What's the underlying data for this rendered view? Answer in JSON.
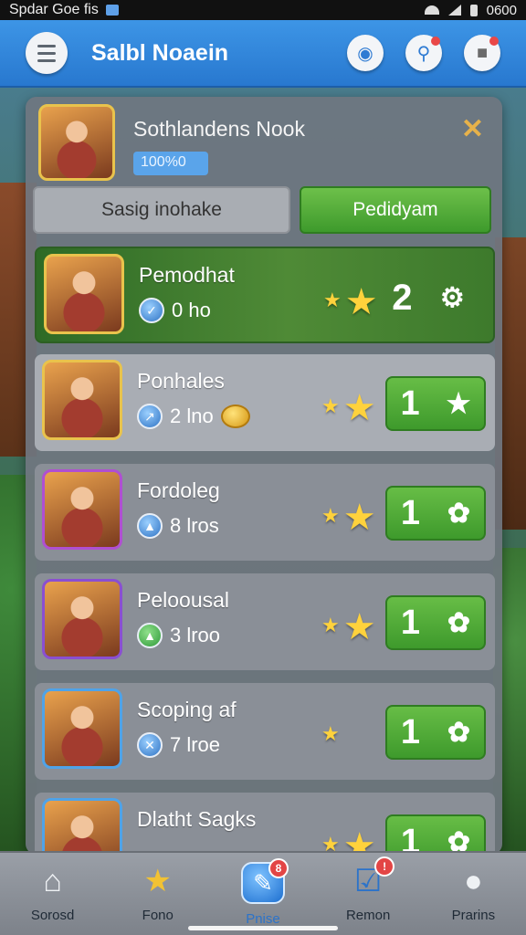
{
  "status_bar": {
    "left_text": "Spdar Goe fis",
    "time": "0600"
  },
  "app_bar": {
    "title": "Salbl Noaein"
  },
  "profile": {
    "name": "Sothlandens Nook",
    "badge": "100%0"
  },
  "tabs": [
    {
      "label": "Sasig inohake",
      "active": false
    },
    {
      "label": "Pedidyam",
      "active": true
    }
  ],
  "entries": [
    {
      "name": "Pemodhat",
      "sub": "0 ho",
      "score": "2",
      "score_icon": "gear-icon"
    },
    {
      "name": "Ponhales",
      "sub": "2 lno",
      "score": "1",
      "score_icon": "star-icon"
    },
    {
      "name": "Fordoleg",
      "sub": "8 lros",
      "score": "1",
      "score_icon": "badge-icon"
    },
    {
      "name": "Peloousal",
      "sub": "3 lroo",
      "score": "1",
      "score_icon": "badge-icon"
    },
    {
      "name": "Scoping af",
      "sub": "7 lroe",
      "score": "1",
      "score_icon": "badge-icon"
    },
    {
      "name": "Dlatht Sagks",
      "sub": "",
      "score": "1",
      "score_icon": "badge-icon"
    }
  ],
  "bottom_nav": [
    {
      "label": "Sorosd",
      "icon": "home-icon",
      "badge": ""
    },
    {
      "label": "Fono",
      "icon": "star-icon",
      "badge": ""
    },
    {
      "label": "Pnise",
      "icon": "chat-icon",
      "badge": "8",
      "active": true
    },
    {
      "label": "Remon",
      "icon": "mail-icon",
      "badge": ""
    },
    {
      "label": "Prarins",
      "icon": "person-icon",
      "badge": ""
    }
  ],
  "colors": {
    "accent_blue": "#2878cf",
    "accent_green": "#4fa636",
    "star_gold": "#ffd23c",
    "badge_red": "#e34545"
  }
}
